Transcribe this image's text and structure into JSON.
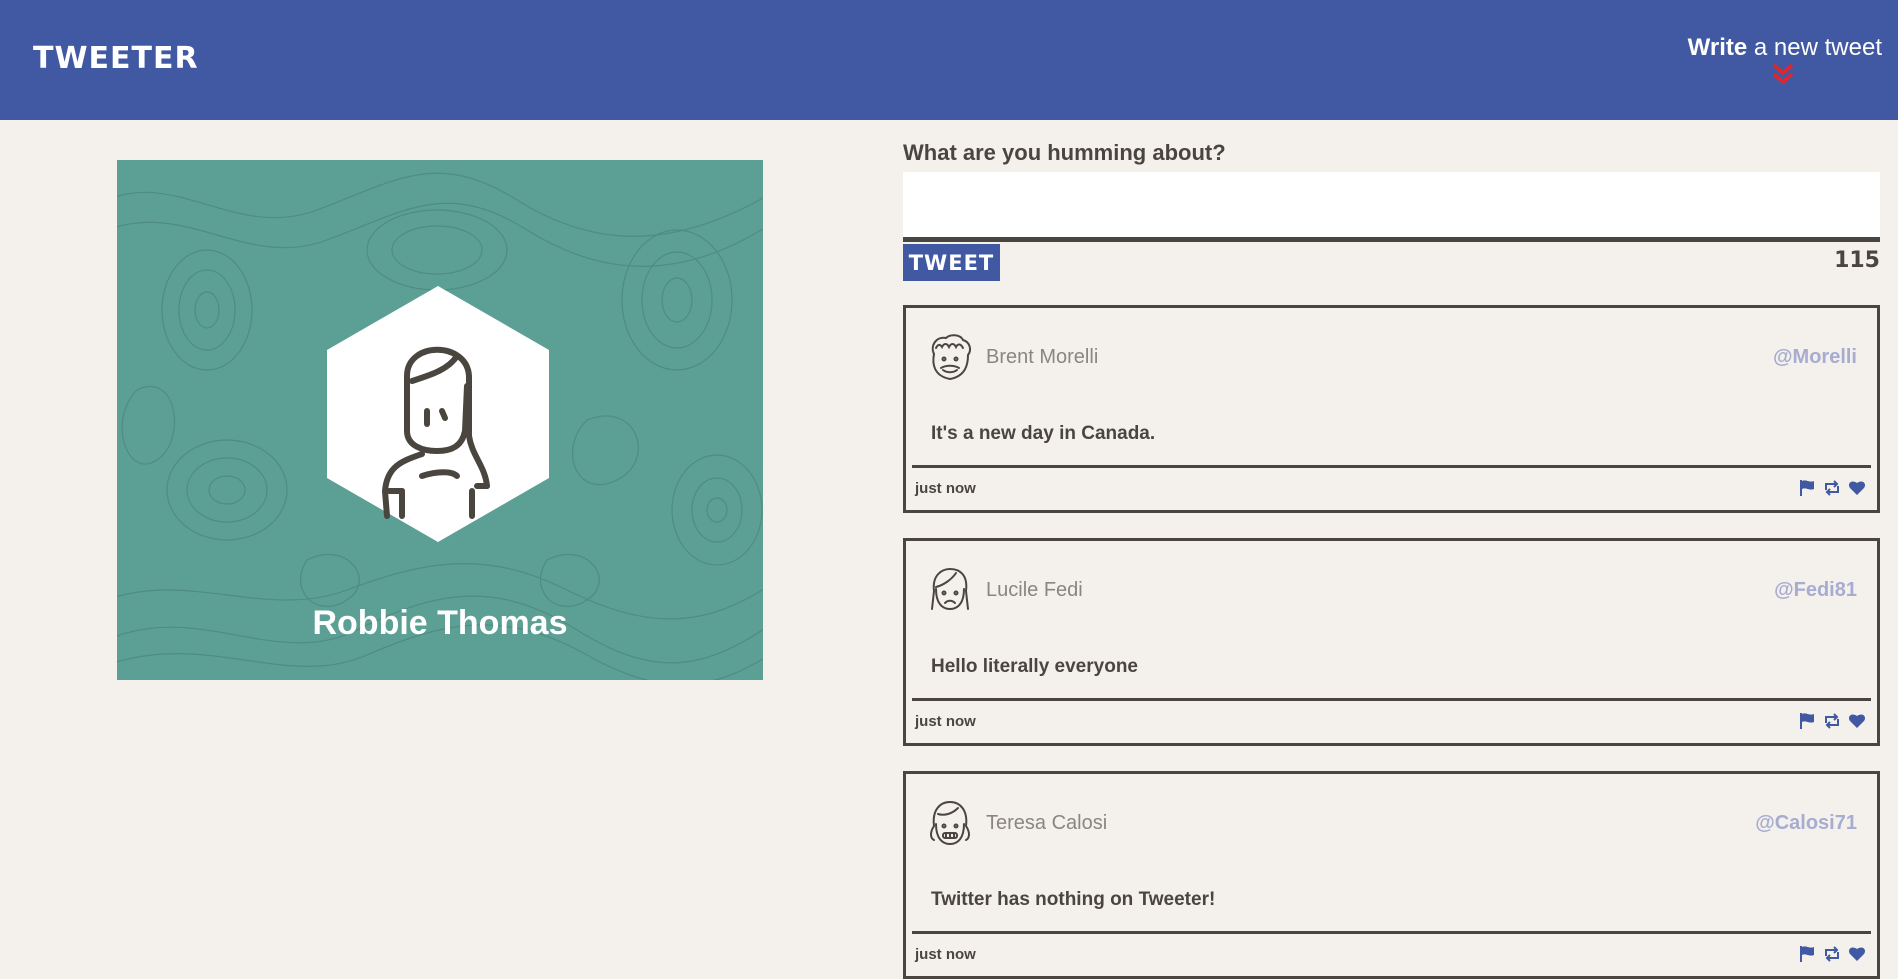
{
  "header": {
    "logo": "TWEETER",
    "write_bold": "Write",
    "write_rest": " a new tweet"
  },
  "profile": {
    "name": "Robbie Thomas"
  },
  "composer": {
    "label": "What are you humming about?",
    "value": "",
    "button_label": "TWEET",
    "counter": "115"
  },
  "tweets": [
    {
      "name": "Brent Morelli",
      "handle": "@Morelli",
      "text": "It's a new day in Canada.",
      "time": "just now",
      "avatar": "man-curly-hair-avatar"
    },
    {
      "name": "Lucile Fedi",
      "handle": "@Fedi81",
      "text": "Hello literally everyone",
      "time": "just now",
      "avatar": "woman-sad-avatar"
    },
    {
      "name": "Teresa Calosi",
      "handle": "@Calosi71",
      "text": "Twitter has nothing on Tweeter!",
      "time": "just now",
      "avatar": "girl-braces-avatar"
    }
  ],
  "colors": {
    "header": "#4158a3",
    "background": "#f4f1ec",
    "profile_card": "#5c9f94",
    "handle": "#a7acd0",
    "chevron": "#e0262b",
    "text": "#4a463f"
  },
  "icons": {
    "flag": "flag-icon",
    "retweet": "retweet-icon",
    "like": "heart-icon"
  }
}
